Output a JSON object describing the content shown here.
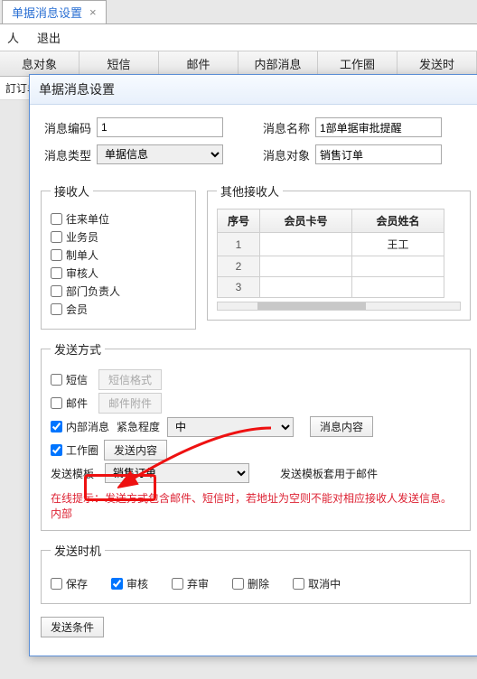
{
  "topTab": {
    "label": "单据消息设置",
    "close": "×"
  },
  "menu": {
    "people": "人",
    "exit": "退出"
  },
  "columns": [
    "息对象",
    "短信",
    "邮件",
    "内部消息",
    "工作圈",
    "发送时"
  ],
  "subRow": "訂订单",
  "modal": {
    "title": "单据消息设置",
    "msgCodeLabel": "消息编码",
    "msgCode": "1",
    "msgNameLabel": "消息名称",
    "msgName": "1部单据审批提醒",
    "msgTypeLabel": "消息类型",
    "msgType": "单据信息",
    "msgObjLabel": "消息对象",
    "msgObj": "销售订单"
  },
  "recipients": {
    "legend": "接收人",
    "items": [
      "往来单位",
      "业务员",
      "制单人",
      "审核人",
      "部门负责人",
      "会员"
    ]
  },
  "otherRecipients": {
    "legend": "其他接收人",
    "headers": [
      "序号",
      "会员卡号",
      "会员姓名"
    ],
    "rows": [
      {
        "no": "1",
        "card": "",
        "name": "王工"
      },
      {
        "no": "2",
        "card": "",
        "name": ""
      },
      {
        "no": "3",
        "card": "",
        "name": ""
      }
    ]
  },
  "sendMethod": {
    "legend": "发送方式",
    "sms": "短信",
    "smsFmtBtn": "短信格式",
    "mail": "邮件",
    "mailAttBtn": "邮件附件",
    "internal": "内部消息",
    "urgencyLabel": "紧急程度",
    "urgencyVal": "中",
    "contentBtn": "消息内容",
    "workCircle": "工作圈",
    "workContentBtn": "发送内容",
    "templateLabel": "发送模板",
    "templateVal": "销售订单",
    "templateNote": "发送模板套用于邮件",
    "onlineTip": "在线提示：发送方式包含邮件、短信时，若地址为空则不能对相应接收人发送信息。内部"
  },
  "timing": {
    "legend": "发送时机",
    "items": [
      "保存",
      "审核",
      "弃审",
      "删除",
      "取消中"
    ],
    "checked": [
      false,
      true,
      false,
      false,
      false
    ]
  },
  "condBtn": "发送条件"
}
